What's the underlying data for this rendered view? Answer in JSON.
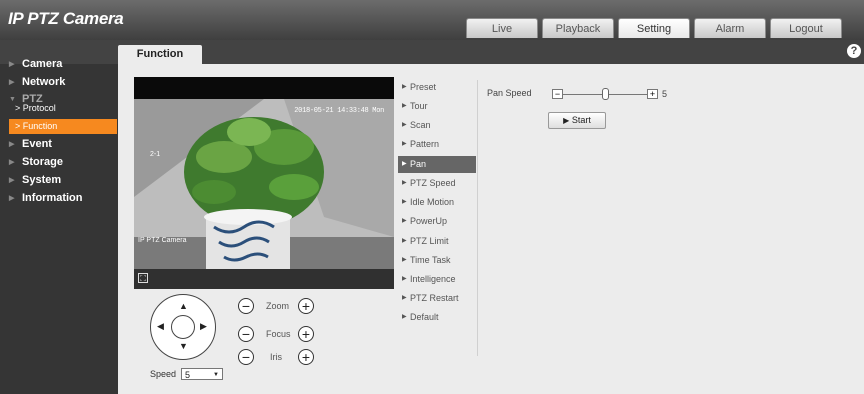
{
  "app": {
    "title": "IP PTZ Camera"
  },
  "tabs": [
    "Live",
    "Playback",
    "Setting",
    "Alarm",
    "Logout"
  ],
  "active_tab": "Setting",
  "page_tab": "Function",
  "help_icon": "?",
  "sidebar": {
    "items": [
      {
        "label": "Camera"
      },
      {
        "label": "Network"
      },
      {
        "label": "PTZ"
      },
      {
        "label": "Event"
      },
      {
        "label": "Storage"
      },
      {
        "label": "System"
      },
      {
        "label": "Information"
      }
    ],
    "ptz_sub": [
      {
        "label": "Protocol"
      },
      {
        "label": "Function"
      }
    ],
    "active_sub": "Function"
  },
  "video": {
    "timestamp": "2018-05-21 14:33:48 Mon",
    "channel": "2-1",
    "camera_name": "IP PTZ Camera"
  },
  "ptz": {
    "speed_label": "Speed",
    "speed_value": "5",
    "zoom_label": "Zoom",
    "focus_label": "Focus",
    "iris_label": "Iris"
  },
  "menu": {
    "items": [
      "Preset",
      "Tour",
      "Scan",
      "Pattern",
      "Pan",
      "PTZ Speed",
      "Idle Motion",
      "PowerUp",
      "PTZ Limit",
      "Time Task",
      "Intelligence",
      "PTZ Restart",
      "Default"
    ],
    "active": "Pan"
  },
  "pan": {
    "speed_label": "Pan Speed",
    "speed_value": "5",
    "speed_fraction": 0.5,
    "start_label": "Start"
  },
  "colors": {
    "accent_orange": "#f6891f",
    "sidebar_bg": "#353535",
    "active_menu_bg": "#666666"
  }
}
